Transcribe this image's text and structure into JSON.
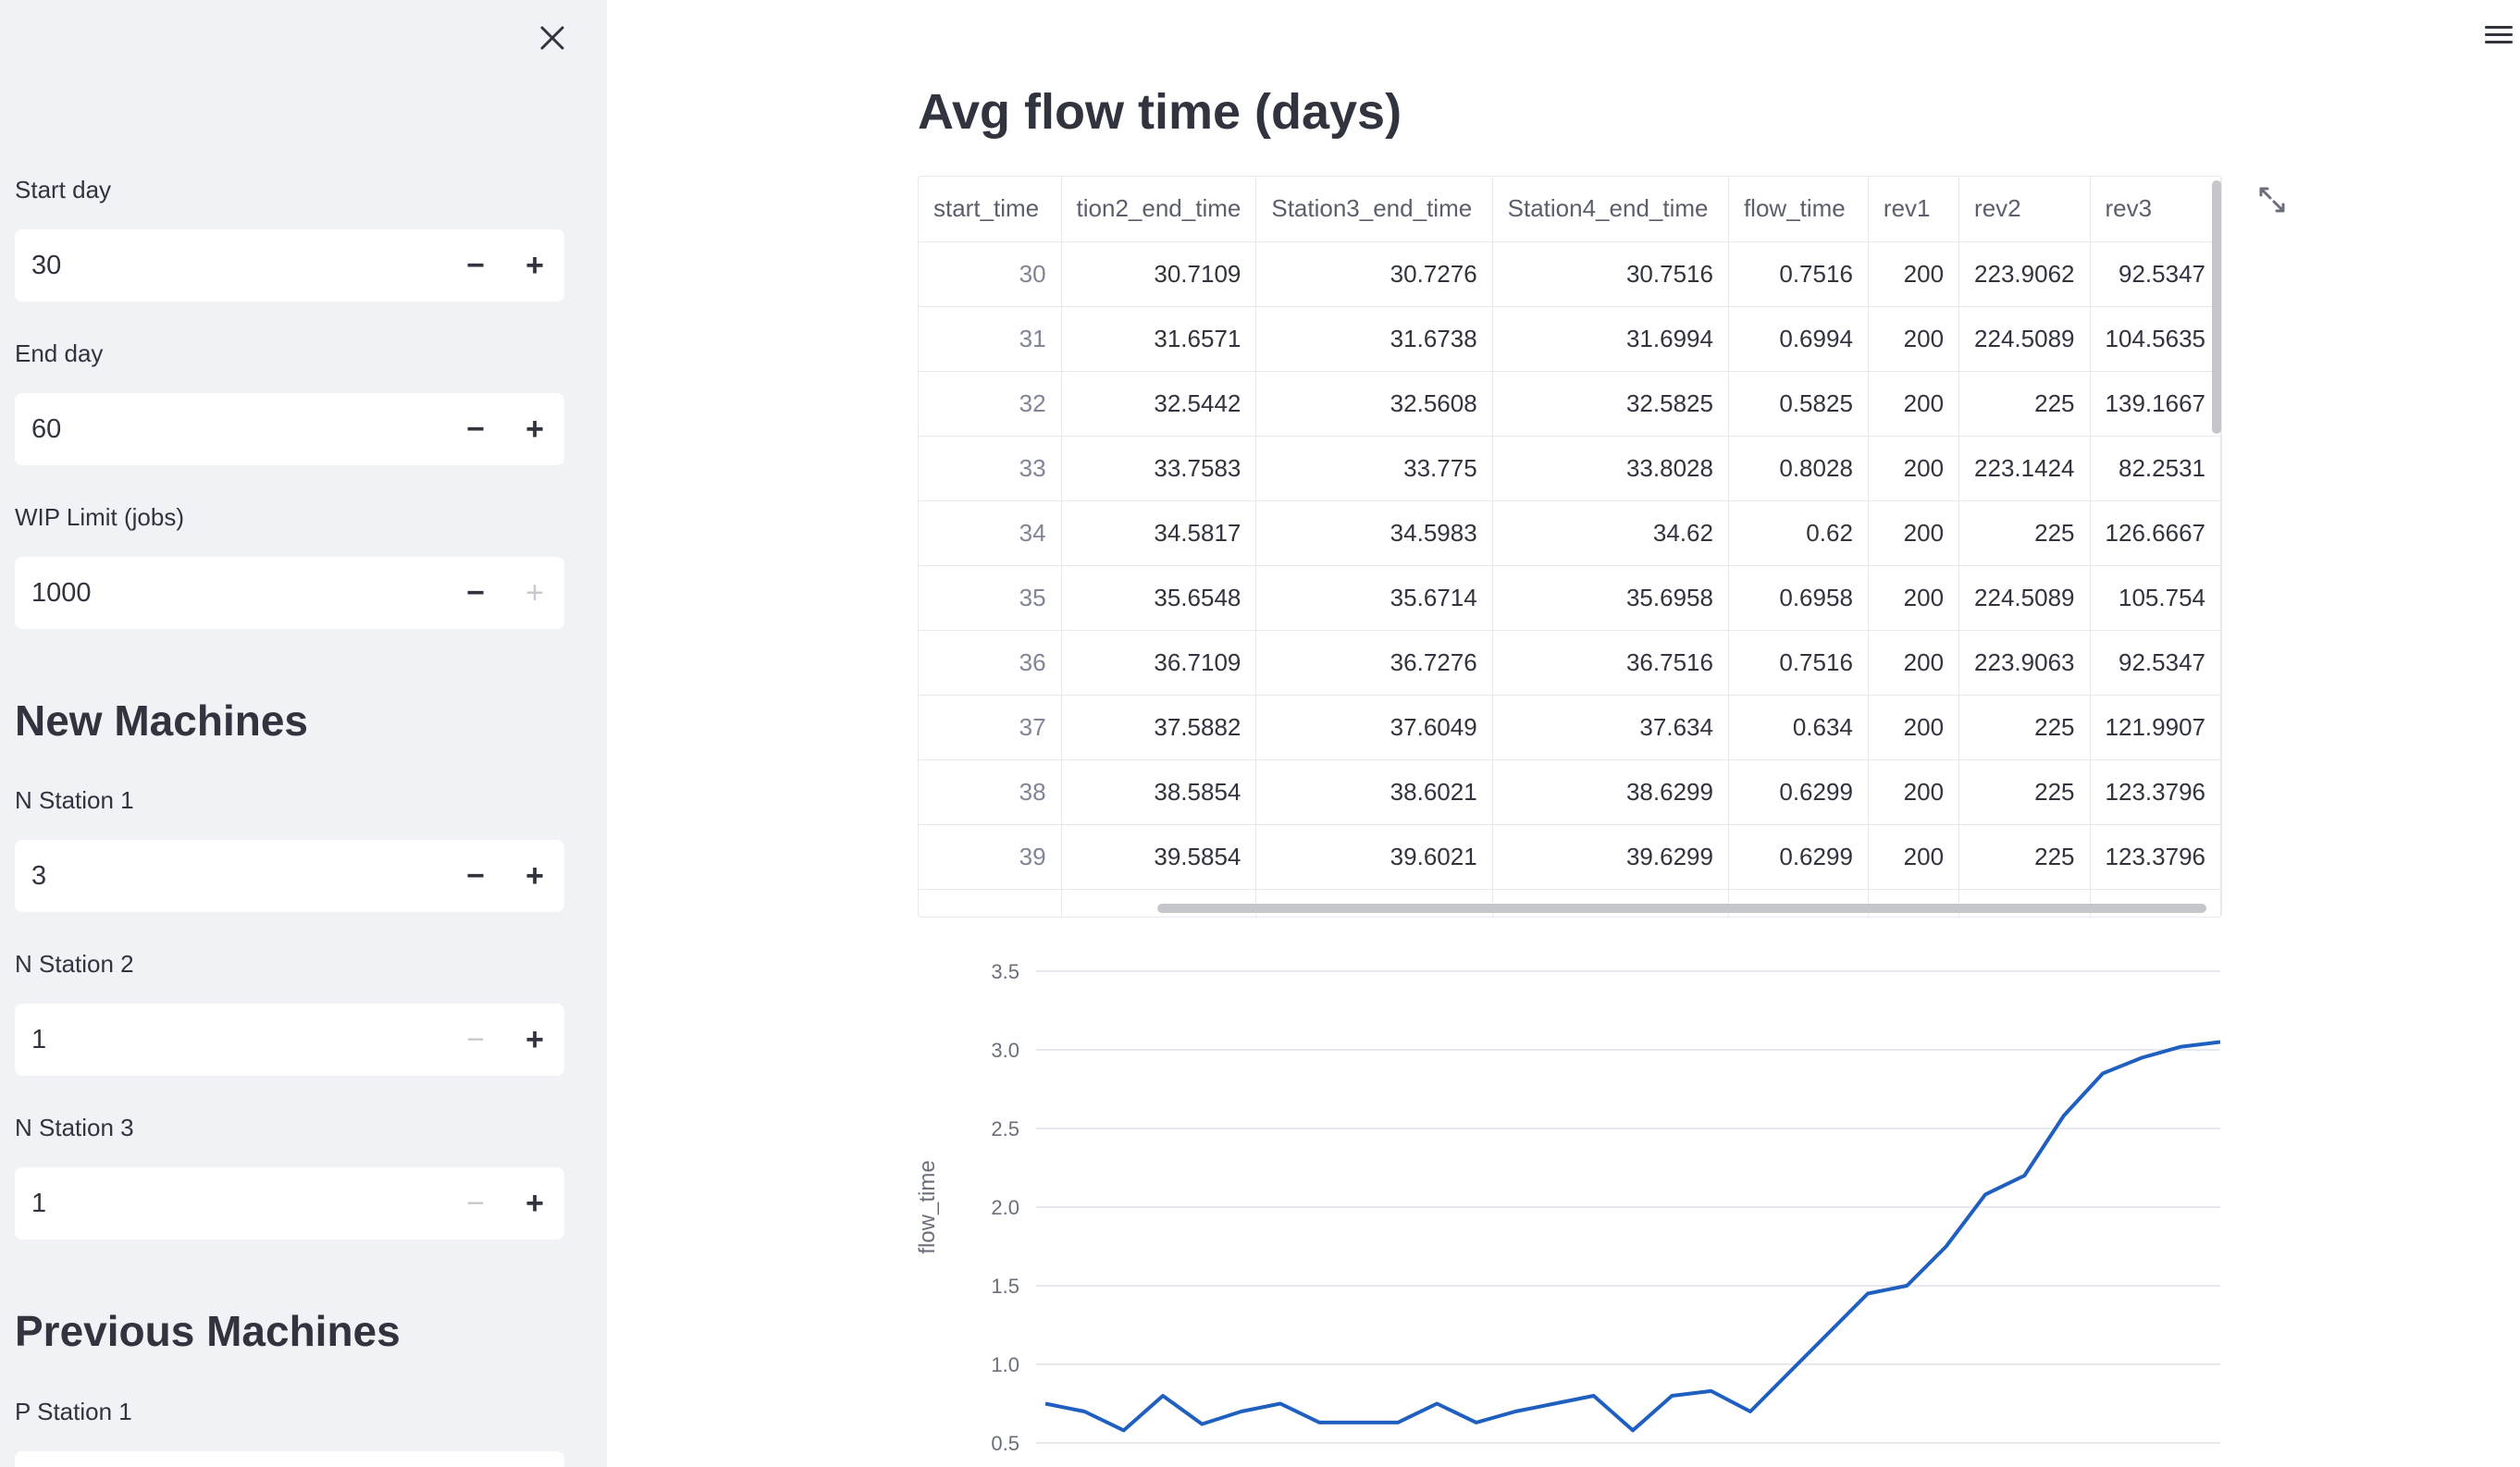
{
  "sidebar": {
    "inputs": {
      "start_day": {
        "label": "Start day",
        "value": "30"
      },
      "end_day": {
        "label": "End day",
        "value": "60"
      },
      "wip_limit": {
        "label": "WIP Limit (jobs)",
        "value": "1000"
      },
      "n_station_1": {
        "label": "N Station 1",
        "value": "3"
      },
      "n_station_2": {
        "label": "N Station 2",
        "value": "1"
      },
      "n_station_3": {
        "label": "N Station 3",
        "value": "1"
      },
      "p_station_1": {
        "label": "P Station 1"
      }
    },
    "new_machines_heading": "New Machines",
    "previous_machines_heading": "Previous Machines",
    "minus_glyph": "−",
    "plus_glyph": "+"
  },
  "main": {
    "title": "Avg flow time (days)",
    "table": {
      "columns": [
        "start_time",
        "tion2_end_time",
        "Station3_end_time",
        "Station4_end_time",
        "flow_time",
        "rev1",
        "rev2",
        "rev3"
      ],
      "rows": [
        [
          "30",
          "30.7109",
          "30.7276",
          "30.7516",
          "0.7516",
          "200",
          "223.9062",
          "92.5347"
        ],
        [
          "31",
          "31.6571",
          "31.6738",
          "31.6994",
          "0.6994",
          "200",
          "224.5089",
          "104.5635"
        ],
        [
          "32",
          "32.5442",
          "32.5608",
          "32.5825",
          "0.5825",
          "200",
          "225",
          "139.1667"
        ],
        [
          "33",
          "33.7583",
          "33.775",
          "33.8028",
          "0.8028",
          "200",
          "223.1424",
          "82.2531"
        ],
        [
          "34",
          "34.5817",
          "34.5983",
          "34.62",
          "0.62",
          "200",
          "225",
          "126.6667"
        ],
        [
          "35",
          "35.6548",
          "35.6714",
          "35.6958",
          "0.6958",
          "200",
          "224.5089",
          "105.754"
        ],
        [
          "36",
          "36.7109",
          "36.7276",
          "36.7516",
          "0.7516",
          "200",
          "223.9063",
          "92.5347"
        ],
        [
          "37",
          "37.5882",
          "37.6049",
          "37.634",
          "0.634",
          "200",
          "225",
          "121.9907"
        ],
        [
          "38",
          "38.5854",
          "38.6021",
          "38.6299",
          "0.6299",
          "200",
          "225",
          "123.3796"
        ],
        [
          "39",
          "39.5854",
          "39.6021",
          "39.6299",
          "0.6299",
          "200",
          "225",
          "123.3796"
        ]
      ]
    }
  },
  "chart_data": {
    "type": "line",
    "ylabel": "flow_time",
    "xlabel": "",
    "yticks": [
      "0.5",
      "1.0",
      "1.5",
      "2.0",
      "2.5",
      "3.0",
      "3.5"
    ],
    "ylim": [
      0.5,
      3.5
    ],
    "series": [
      {
        "values": [
          0.75,
          0.7,
          0.58,
          0.8,
          0.62,
          0.7,
          0.75,
          0.63,
          0.63,
          0.63,
          0.75,
          0.63,
          0.7,
          0.75,
          0.8,
          0.58,
          0.8,
          0.83,
          0.7,
          0.95,
          1.2,
          1.45,
          1.5,
          1.75,
          2.08,
          2.2,
          2.58,
          2.85,
          2.95,
          3.02,
          3.05
        ],
        "color": "#1f5fbf"
      }
    ]
  }
}
